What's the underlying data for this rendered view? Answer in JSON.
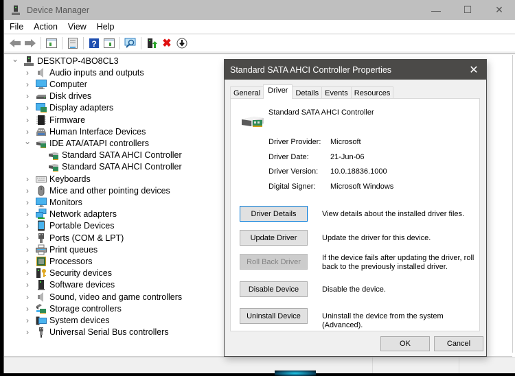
{
  "window": {
    "title": "Device Manager",
    "controls": {
      "minimize": "—",
      "maximize": "☐",
      "close": "✕"
    }
  },
  "menu": [
    "File",
    "Action",
    "View",
    "Help"
  ],
  "toolbar": {
    "icons": [
      "back-arrow-icon",
      "forward-arrow-icon",
      "show-hide-console-tree-icon",
      "properties-icon",
      "help-icon",
      "action-pane-icon",
      "scan-hardware-changes-icon",
      "update-driver-icon",
      "uninstall-device-icon",
      "disable-device-icon"
    ],
    "uninstall_glyph": "✖",
    "help_glyph": "?",
    "disable_glyph": "⬇"
  },
  "tree": {
    "root": {
      "label": "DESKTOP-4BO8CL3",
      "expanded": true
    },
    "categories": [
      {
        "label": "Audio inputs and outputs",
        "icon": "speaker-icon",
        "expanded": false
      },
      {
        "label": "Computer",
        "icon": "computer-icon",
        "expanded": false
      },
      {
        "label": "Disk drives",
        "icon": "disk-drive-icon",
        "expanded": false
      },
      {
        "label": "Display adapters",
        "icon": "display-adapter-icon",
        "expanded": false
      },
      {
        "label": "Firmware",
        "icon": "firmware-chip-icon",
        "expanded": false
      },
      {
        "label": "Human Interface Devices",
        "icon": "hid-icon",
        "expanded": false
      },
      {
        "label": "IDE ATA/ATAPI controllers",
        "icon": "ide-controller-icon",
        "expanded": true,
        "children": [
          "Standard SATA AHCI Controller",
          "Standard SATA AHCI Controller"
        ]
      },
      {
        "label": "Keyboards",
        "icon": "keyboard-icon",
        "expanded": false
      },
      {
        "label": "Mice and other pointing devices",
        "icon": "mouse-icon",
        "expanded": false
      },
      {
        "label": "Monitors",
        "icon": "monitor-icon",
        "expanded": false
      },
      {
        "label": "Network adapters",
        "icon": "network-adapter-icon",
        "expanded": false
      },
      {
        "label": "Portable Devices",
        "icon": "portable-device-icon",
        "expanded": false
      },
      {
        "label": "Ports (COM & LPT)",
        "icon": "port-icon",
        "expanded": false
      },
      {
        "label": "Print queues",
        "icon": "printer-icon",
        "expanded": false
      },
      {
        "label": "Processors",
        "icon": "processor-icon",
        "expanded": false
      },
      {
        "label": "Security devices",
        "icon": "security-device-icon",
        "expanded": false
      },
      {
        "label": "Software devices",
        "icon": "software-device-icon",
        "expanded": false
      },
      {
        "label": "Sound, video and game controllers",
        "icon": "speaker-icon",
        "expanded": false
      },
      {
        "label": "Storage controllers",
        "icon": "storage-controller-icon",
        "expanded": false
      },
      {
        "label": "System devices",
        "icon": "system-device-icon",
        "expanded": false
      },
      {
        "label": "Universal Serial Bus controllers",
        "icon": "usb-icon",
        "expanded": false
      }
    ]
  },
  "dialog": {
    "title": "Standard SATA AHCI Controller Properties",
    "close_glyph": "✕",
    "tabs": [
      "General",
      "Driver",
      "Details",
      "Events",
      "Resources"
    ],
    "active_tab": "Driver",
    "device_name": "Standard SATA AHCI Controller",
    "info": [
      {
        "label": "Driver Provider:",
        "value": "Microsoft"
      },
      {
        "label": "Driver Date:",
        "value": "21-Jun-06"
      },
      {
        "label": "Driver Version:",
        "value": "10.0.18836.1000"
      },
      {
        "label": "Digital Signer:",
        "value": "Microsoft Windows"
      }
    ],
    "actions": [
      {
        "button": "Driver Details",
        "description": "View details about the installed driver files.",
        "state": "focused"
      },
      {
        "button": "Update Driver",
        "description": "Update the driver for this device.",
        "state": "normal"
      },
      {
        "button": "Roll Back Driver",
        "description": "If the device fails after updating the driver, roll back to the previously installed driver.",
        "state": "disabled"
      },
      {
        "button": "Disable Device",
        "description": "Disable the device.",
        "state": "normal"
      },
      {
        "button": "Uninstall Device",
        "description": "Uninstall the device from the system (Advanced).",
        "state": "normal"
      }
    ],
    "ok_label": "OK",
    "cancel_label": "Cancel"
  }
}
